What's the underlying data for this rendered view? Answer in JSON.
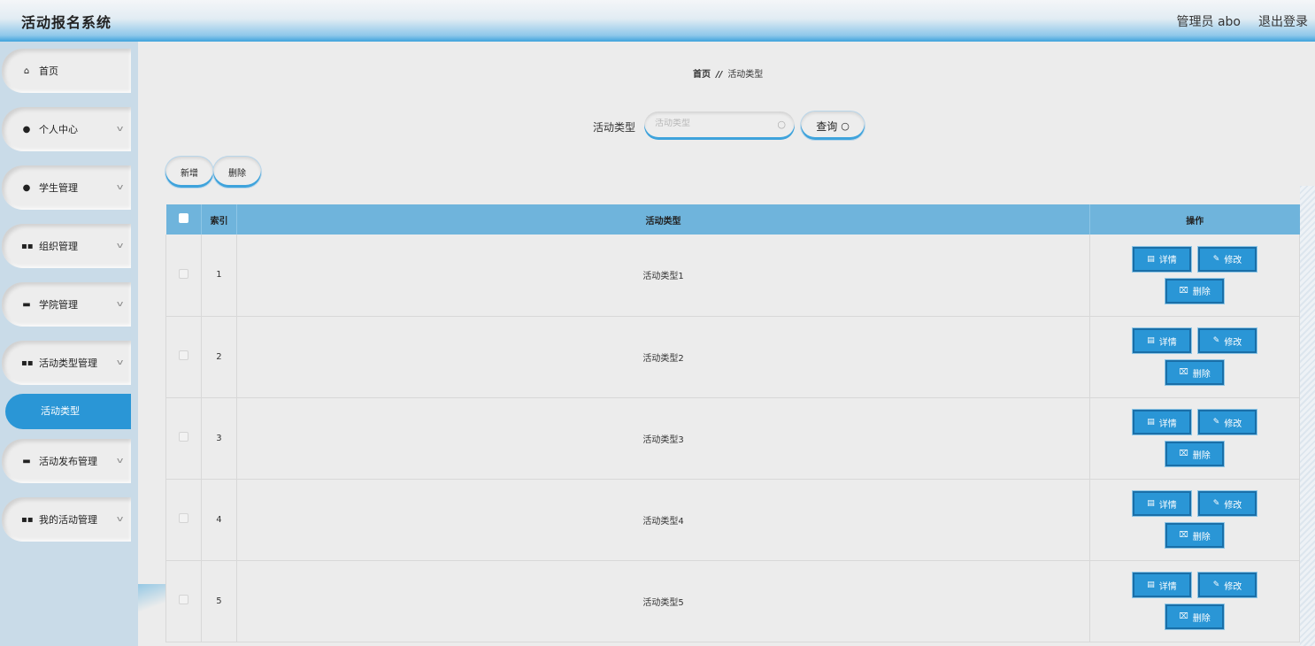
{
  "header": {
    "title": "活动报名系统",
    "user": "管理员 abo",
    "logout": "退出登录"
  },
  "sidebar": {
    "items": [
      {
        "label": "首页",
        "icon": "home-icon"
      },
      {
        "label": "个人中心",
        "icon": "user-icon"
      },
      {
        "label": "学生管理",
        "icon": "user-icon"
      },
      {
        "label": "组织管理",
        "icon": "grid-icon"
      },
      {
        "label": "学院管理",
        "icon": "briefcase-icon"
      },
      {
        "label": "活动类型管理",
        "icon": "grid-icon"
      },
      {
        "label": "活动发布管理",
        "icon": "briefcase-icon"
      },
      {
        "label": "我的活动管理",
        "icon": "grid-icon"
      }
    ],
    "active_sub": "活动类型"
  },
  "breadcrumb": {
    "home": "首页",
    "separator": "//",
    "current": "活动类型"
  },
  "search": {
    "label": "活动类型",
    "placeholder": "活动类型",
    "button": "查询"
  },
  "toolbar": {
    "add": "新增",
    "delete": "删除"
  },
  "table": {
    "columns": [
      "索引",
      "活动类型",
      "操作"
    ],
    "rows": [
      {
        "index": "1",
        "type": "活动类型1"
      },
      {
        "index": "2",
        "type": "活动类型2"
      },
      {
        "index": "3",
        "type": "活动类型3"
      },
      {
        "index": "4",
        "type": "活动类型4"
      },
      {
        "index": "5",
        "type": "活动类型5"
      }
    ],
    "actions": {
      "detail": "详情",
      "edit": "修改",
      "delete": "删除"
    }
  },
  "colors": {
    "accent": "#2a96d6",
    "header_row": "#6fb4dc",
    "sidebar_bg": "#c9dbe8"
  }
}
